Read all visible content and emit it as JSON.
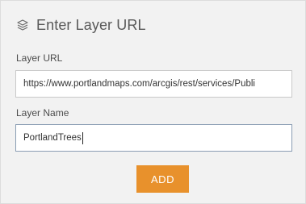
{
  "header": {
    "icon": "layers-icon",
    "title": "Enter Layer URL"
  },
  "form": {
    "url_label": "Layer URL",
    "url_value": "https://www.portlandmaps.com/arcgis/rest/services/Publi",
    "name_label": "Layer Name",
    "name_value": "PortlandTrees"
  },
  "actions": {
    "add_label": "ADD",
    "add_color": "#e8912c"
  }
}
